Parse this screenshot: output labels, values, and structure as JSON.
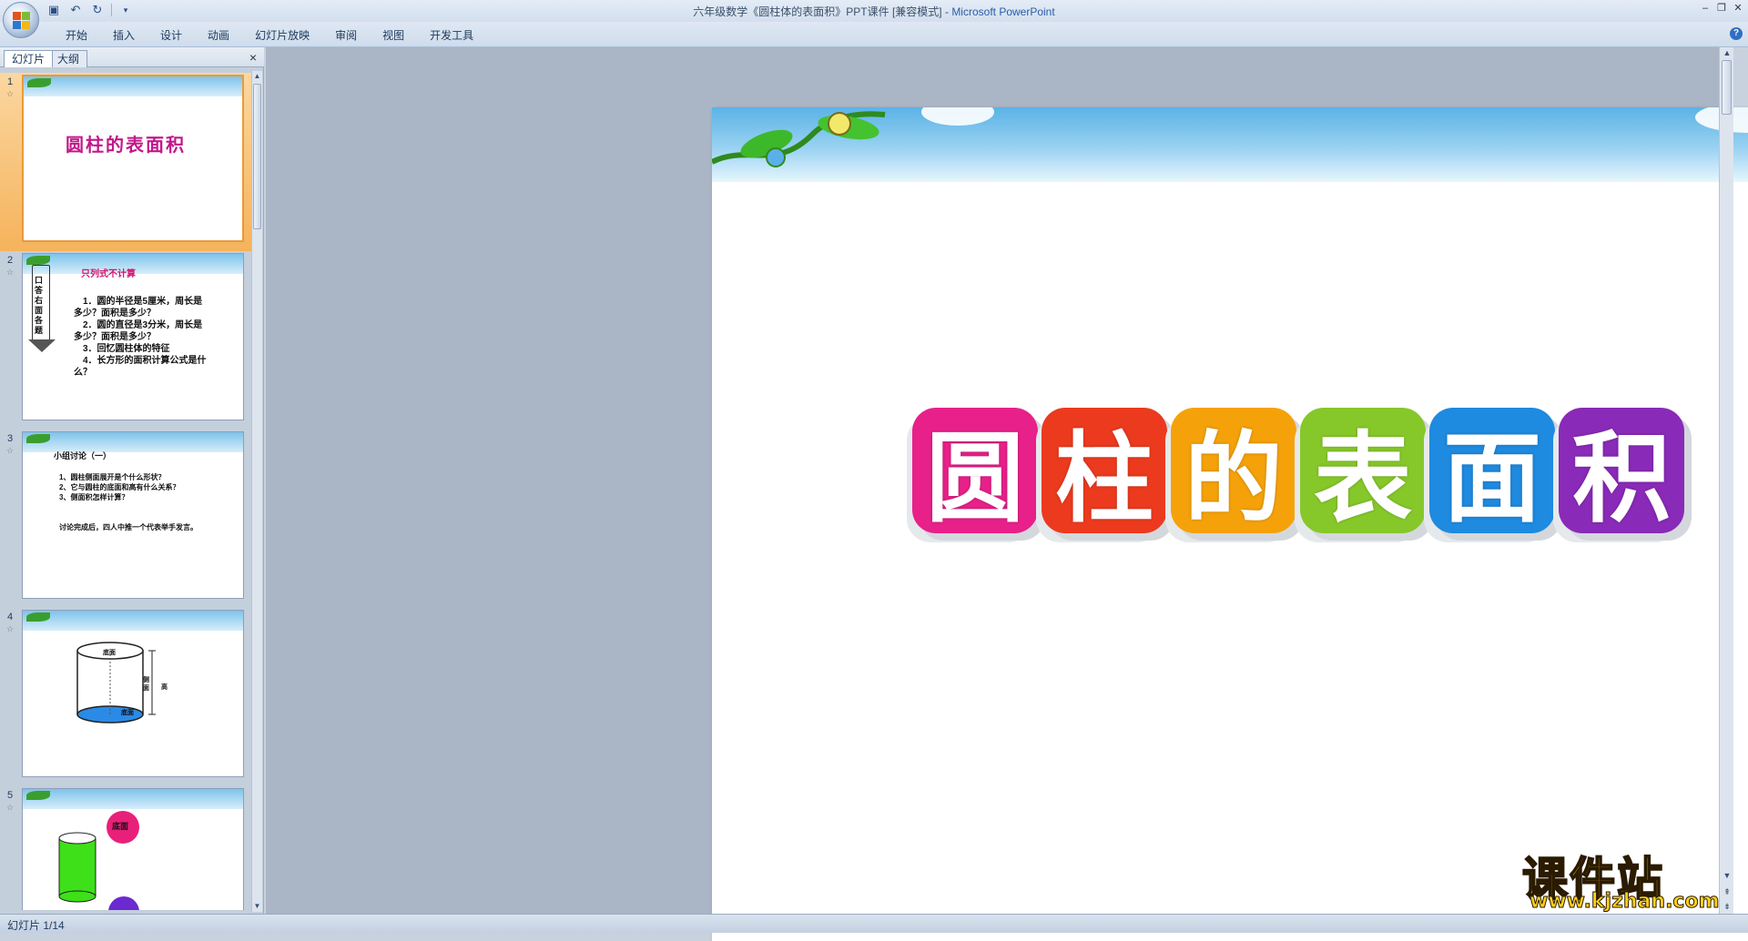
{
  "window": {
    "title": "六年级数学《圆柱体的表面积》PPT课件 [兼容模式] - ",
    "app_name": "Microsoft PowerPoint"
  },
  "quick_access": {
    "save": "save-icon",
    "undo": "undo-icon",
    "redo": "redo-icon"
  },
  "ribbon": {
    "tabs": [
      "开始",
      "插入",
      "设计",
      "动画",
      "幻灯片放映",
      "审阅",
      "视图",
      "开发工具"
    ]
  },
  "left_pane": {
    "tabs": [
      "幻灯片",
      "大纲"
    ],
    "close": "×",
    "thumbnails": [
      {
        "number": "1",
        "title": "圆柱的表面积"
      },
      {
        "number": "2",
        "side_label": "口答右面各题",
        "heading": "只列式不计算",
        "lines": [
          "1．圆的半径是5厘米，周长是",
          "多少？面积是多少？",
          "2．圆的直径是3分米，周长是",
          "多少？面积是多少？",
          "3．回忆圆柱体的特征",
          "4．长方形的面积计算公式是什",
          "么？"
        ]
      },
      {
        "number": "3",
        "heading": "小组讨论（一）",
        "lines": [
          "1、圆柱侧面展开是个什么形状？",
          "2、它与圆柱的底面和高有什么关系？",
          "3、侧面积怎样计算？"
        ],
        "footer": "讨论完成后，四人中推一个代表举手发言。"
      },
      {
        "number": "4",
        "labels": [
          "底面",
          "侧面",
          "高",
          "底面"
        ]
      },
      {
        "number": "5",
        "label": "底面"
      }
    ]
  },
  "slide": {
    "title_chars": [
      "圆",
      "柱",
      "的",
      "表",
      "面",
      "积"
    ],
    "title_colors": [
      "#e8208a",
      "#ec3a1e",
      "#f5a20a",
      "#86c82a",
      "#1e8ae0",
      "#8a2ab8"
    ]
  },
  "watermark": {
    "brand": "课件站",
    "url": "www.kjzhan.com"
  },
  "status": {
    "slide_counter": "幻灯片 1/14"
  }
}
